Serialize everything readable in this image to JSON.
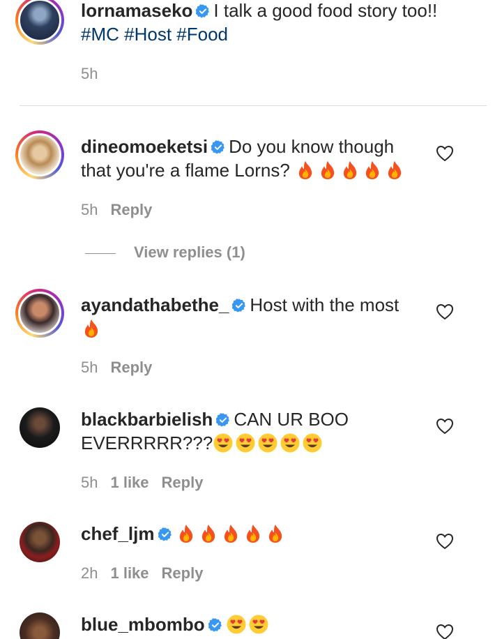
{
  "caption": {
    "username": "lornamaseko",
    "text": "I talk a good food story too!!",
    "hashtags": "#MC #Host #Food",
    "time": "5h"
  },
  "comments": [
    {
      "username": "dineomoeketsi",
      "text": "Do you know though that you're a flame Lorns?",
      "emoji": "fire",
      "emoji_count": 5,
      "time": "5h",
      "likes": "",
      "reply_label": "Reply",
      "view_replies": "View replies (1)"
    },
    {
      "username": "ayandathabethe_",
      "text": "Host with the most",
      "emoji": "fire",
      "emoji_count": 1,
      "time": "5h",
      "likes": "",
      "reply_label": "Reply"
    },
    {
      "username": "blackbarbielish",
      "text": "CAN UR BOO EVERRRRR???",
      "emoji": "heart-eyes",
      "emoji_count": 5,
      "time": "5h",
      "likes": "1 like",
      "reply_label": "Reply"
    },
    {
      "username": "chef_ljm",
      "text": "",
      "emoji": "fire",
      "emoji_count": 5,
      "time": "2h",
      "likes": "1 like",
      "reply_label": "Reply"
    },
    {
      "username": "blue_mbombo",
      "text": "",
      "emoji": "heart-eyes",
      "emoji_count": 2,
      "time": "",
      "likes": "",
      "reply_label": ""
    }
  ],
  "icons": {
    "verified": "verified-badge-icon",
    "like": "heart-outline-icon",
    "fire": "fire-emoji-icon",
    "heart_eyes": "heart-eyes-emoji-icon"
  },
  "colors": {
    "text": "#262626",
    "muted": "#8e8e8e",
    "hashtag": "#00376b",
    "verified": "#3897f0",
    "fire": "#f4511e",
    "emoji_face": "#ffcc33",
    "emoji_heart": "#e53935"
  }
}
